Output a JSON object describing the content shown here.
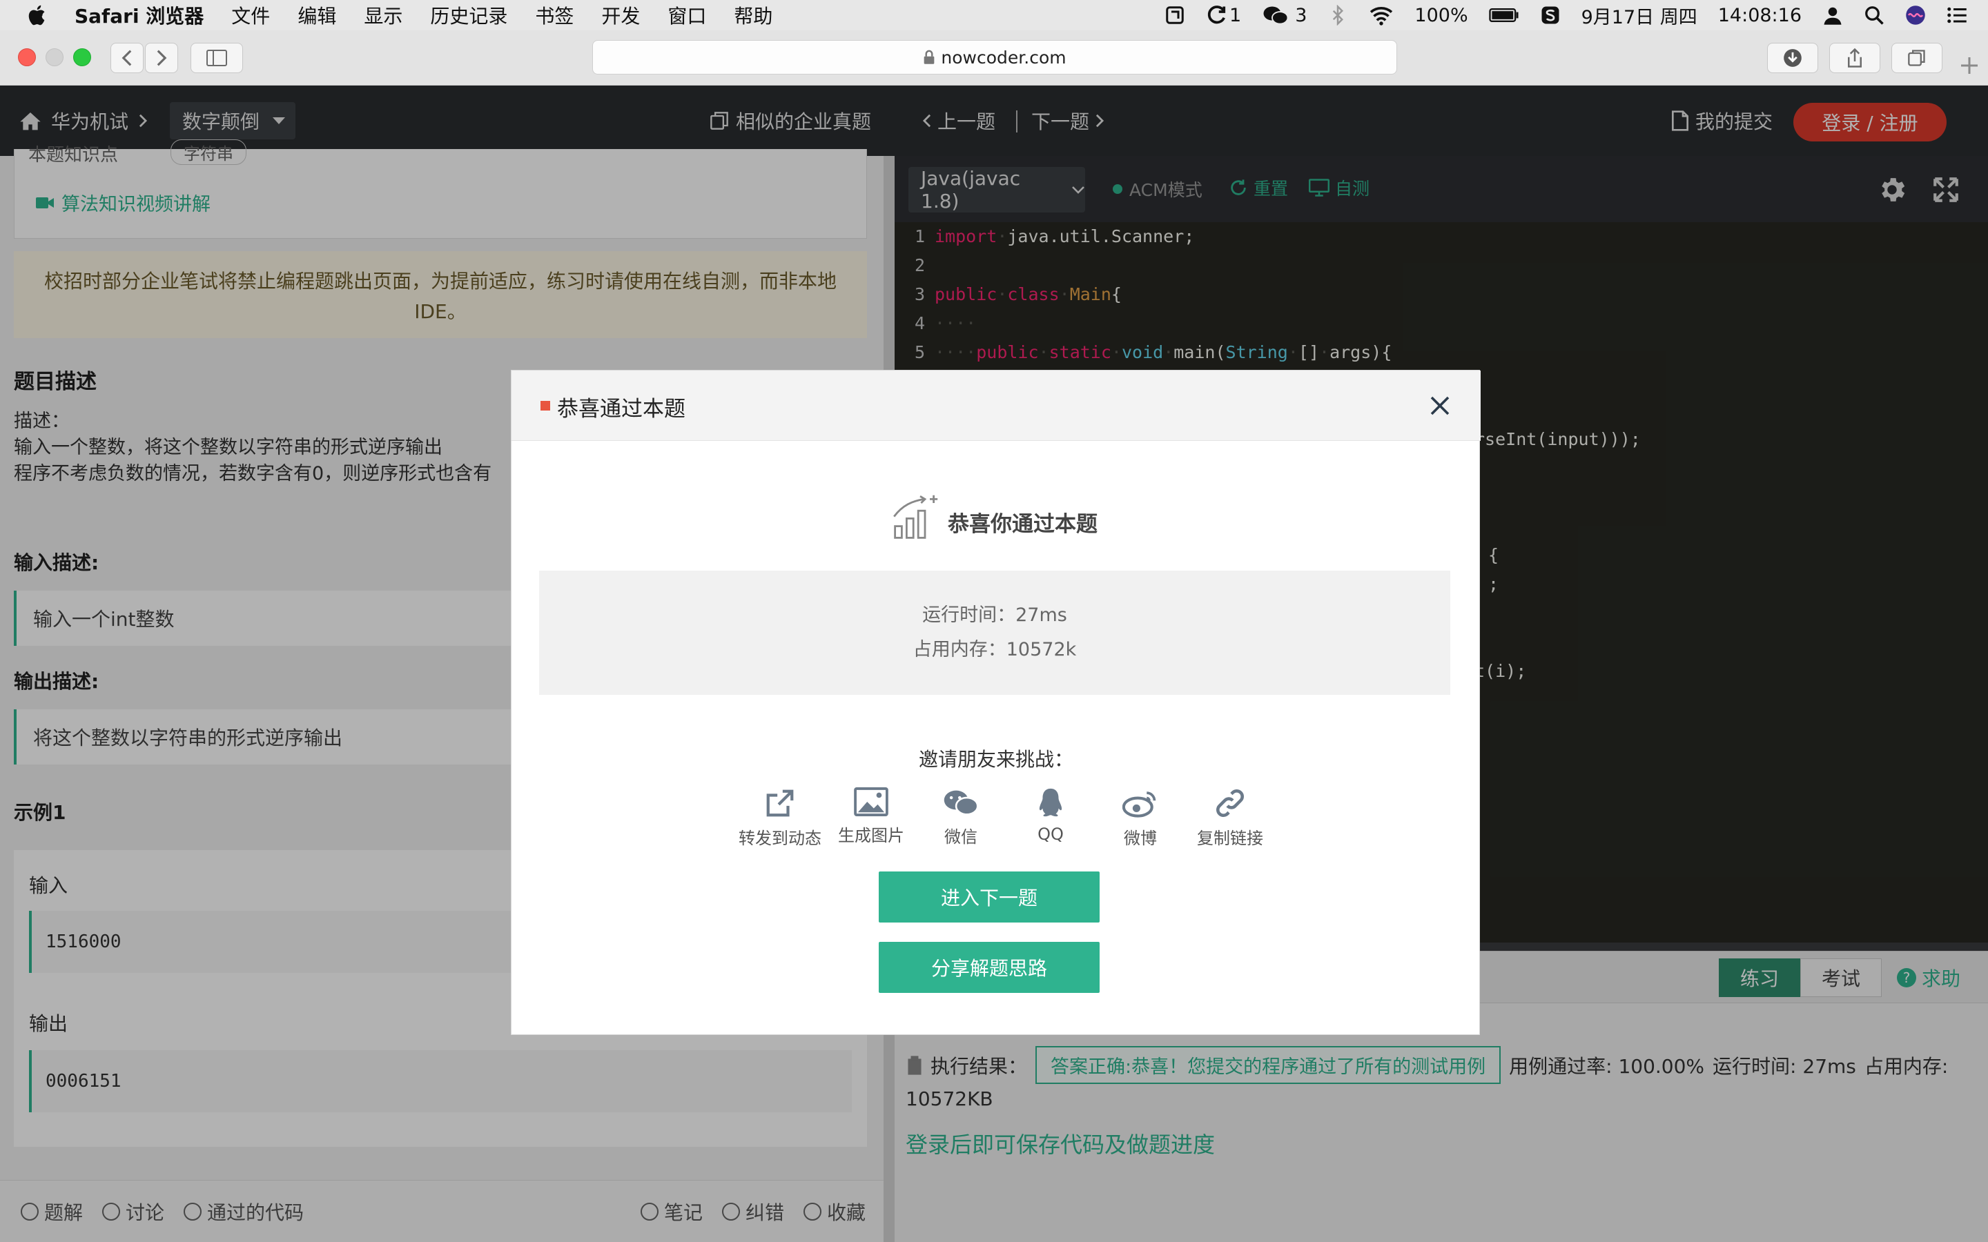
{
  "menubar": {
    "app": "Safari 浏览器",
    "items": [
      "文件",
      "编辑",
      "显示",
      "历史记录",
      "书签",
      "开发",
      "窗口",
      "帮助"
    ],
    "status": {
      "badge1": "1",
      "wechat_count": "3",
      "battery": "100%",
      "date": "9月17日 周四",
      "time": "14:08:16"
    }
  },
  "browser": {
    "url": "nowcoder.com"
  },
  "header": {
    "breadcrumb": "华为机试",
    "dropdown": "数字颠倒",
    "similar": "相似的企业真题",
    "prev": "上一题",
    "next": "下一题",
    "my_submit": "我的提交",
    "login": "登录 / 注册"
  },
  "problem": {
    "knowledge_partial": "本题知识点",
    "tag_partial": "字符串",
    "video": "算法知识视频讲解",
    "notice": "校招时部分企业笔试将禁止编程题跳出页面，为提前适应，练习时请使用在线自测，而非本地IDE。",
    "desc_title": "题目描述",
    "desc_label": "描述：",
    "desc_line1": "输入一个整数，将这个整数以字符串的形式逆序输出",
    "desc_line2": "程序不考虑负数的情况，若数字含有0，则逆序形式也含有",
    "input_title": "输入描述:",
    "input_desc": "输入一个int整数",
    "output_title": "输出描述:",
    "output_desc": "将这个整数以字符串的形式逆序输出",
    "example_title": "示例1",
    "ex_input_label": "输入",
    "ex_input": "1516000",
    "ex_output_label": "输出",
    "ex_output": "0006151"
  },
  "bottom_bar": {
    "solutions": "题解",
    "discuss": "讨论",
    "passed": "通过的代码",
    "notes": "笔记",
    "errata": "纠错",
    "favorite": "收藏"
  },
  "editor": {
    "language": "Java(javac 1.8)",
    "mode": "ACM模式",
    "reset": "重置",
    "selftest": "自测",
    "visible_fragments": [
      "rseInt(input)));",
      "{",
      ";",
      "t(i);"
    ]
  },
  "result": {
    "tab_practice": "练习",
    "tab_exam": "考试",
    "help": "求助",
    "label": "执行结果：",
    "status": "答案正确:恭喜！您提交的程序通过了所有的测试用例",
    "pass_rate": "用例通过率: 100.00%",
    "runtime": "运行时间: 27ms",
    "memory_label": "占用内存:",
    "memory": "10572KB",
    "login_tip": "登录后即可保存代码及做题进度"
  },
  "modal": {
    "title": "恭喜通过本题",
    "headline": "恭喜你通过本题",
    "run_time": "运行时间：27ms",
    "memory": "占用内存：10572k",
    "invite": "邀请朋友来挑战：",
    "shares": [
      "转发到动态",
      "生成图片",
      "微信",
      "QQ",
      "微博",
      "复制链接"
    ],
    "next_btn": "进入下一题",
    "share_btn": "分享解题思路"
  },
  "colors": {
    "accent_green": "#2fb38f",
    "login_red": "#dd3a2c",
    "header_dark": "#2a2d30",
    "editor_bg": "#272822"
  }
}
